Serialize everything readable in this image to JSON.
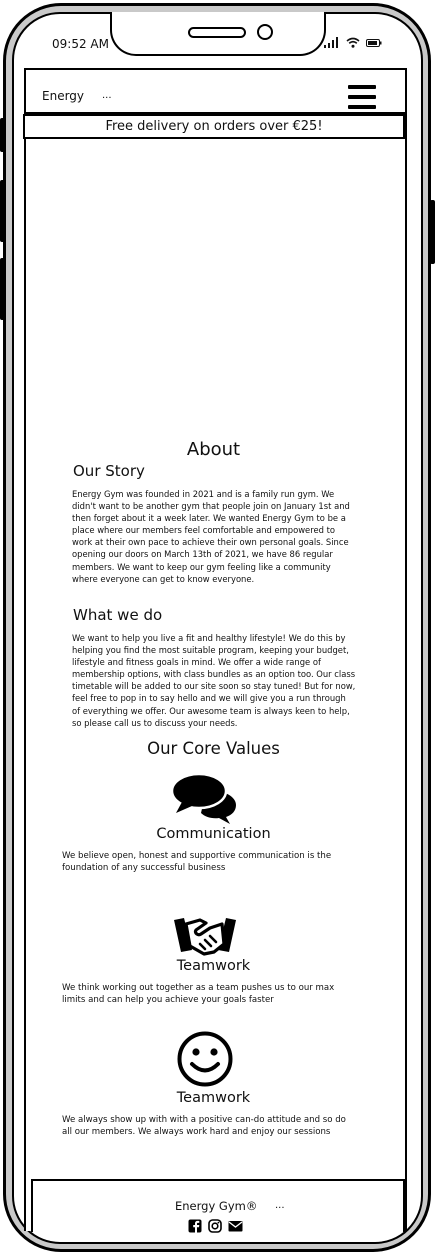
{
  "status_bar": {
    "time": "09:52 AM"
  },
  "navbar": {
    "brand": "Energy",
    "brand_suffix": "..."
  },
  "banner": {
    "text": "Free delivery on orders over €25!"
  },
  "about": {
    "title": "About",
    "story_heading": "Our Story",
    "story_text": "Energy Gym was founded in 2021 and is a family run gym. We didn't want to be another gym that people join on January 1st and then forget about it a week later. We wanted Energy Gym to be a place where our members feel comfortable and empowered to work at their own pace to achieve their own personal goals. Since opening our doors on March 13th of 2021, we have 86 regular members. We want to keep our gym feeling like a community where everyone can get to know everyone.",
    "what_heading": "What we do",
    "what_text": "We want to help you live a fit and healthy lifestyle! We do this by helping you find the most suitable program, keeping your budget, lifestyle and fitness goals in mind. We offer a wide range of membership options, with class bundles as an option too. Our class timetable will be added to our site soon so stay tuned! But for now, feel free to pop in to say hello and we will give you a run through of everything we offer. Our awesome team is always keen to help, so please call us to discuss your needs."
  },
  "core_values": {
    "title": "Our Core Values",
    "items": [
      {
        "icon": "speech-bubbles-icon",
        "title": "Communication",
        "text": "We believe open, honest and supportive communication is the foundation of any successful business"
      },
      {
        "icon": "handshake-icon",
        "title": "Teamwork",
        "text": "We think working out together as a team pushes us to our max limits and can help you achieve your goals faster"
      },
      {
        "icon": "smiley-icon",
        "title": "Teamwork",
        "text": "We always show up with with a positive can-do attitude and so do all our members. We always work hard and enjoy our sessions"
      }
    ]
  },
  "footer": {
    "brand": "Energy Gym®",
    "brand_suffix": "...",
    "social": [
      "facebook-icon",
      "instagram-icon",
      "envelope-icon"
    ]
  },
  "colors": {
    "outline": "#000000",
    "bezel": "#c9c9c9",
    "screen": "#ffffff"
  }
}
